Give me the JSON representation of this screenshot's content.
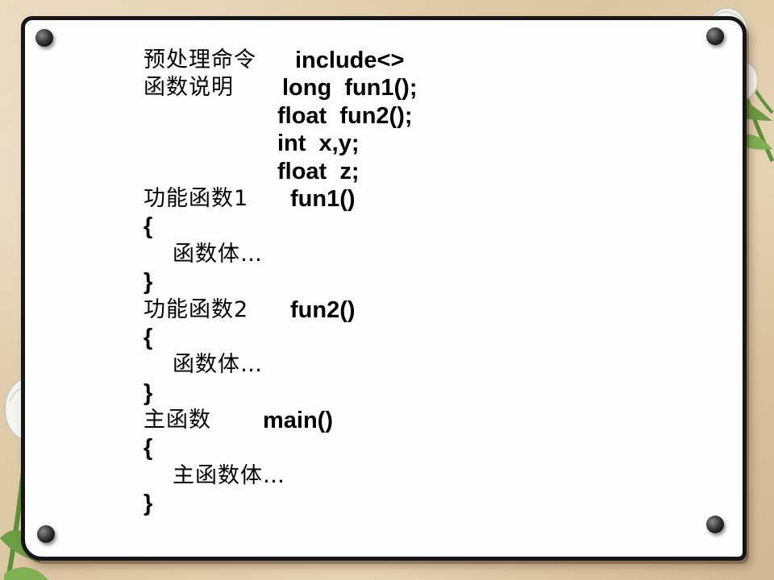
{
  "slide": {
    "lines": [
      {
        "cn": "预处理命令",
        "code": "include<>"
      },
      {
        "cn": "函数说明",
        "code": "long  fun1();"
      },
      {
        "cn": "",
        "code": "float  fun2();"
      },
      {
        "cn": "",
        "code": "int  x,y;"
      },
      {
        "cn": "",
        "code": "float  z;"
      },
      {
        "cn": "功能函数1",
        "code": "fun1()"
      },
      {
        "cn": "",
        "code": "{"
      },
      {
        "cn": "",
        "code": "函数体…"
      },
      {
        "cn": "",
        "code": "}"
      },
      {
        "cn": "功能函数2",
        "code": "fun2()"
      },
      {
        "cn": "",
        "code": "{"
      },
      {
        "cn": "",
        "code": "函数体…"
      },
      {
        "cn": "",
        "code": "}"
      },
      {
        "cn": "主函数",
        "code": "main()"
      },
      {
        "cn": "",
        "code": "{"
      },
      {
        "cn": "",
        "code": "主函数体…"
      },
      {
        "cn": "",
        "code": "}"
      }
    ]
  },
  "colors": {
    "paper": "#fefefe",
    "border": "#161616",
    "background": "#dcc5a2",
    "text": "#000000"
  },
  "icons": [
    "pushpin-icon",
    "tulip-icon"
  ]
}
